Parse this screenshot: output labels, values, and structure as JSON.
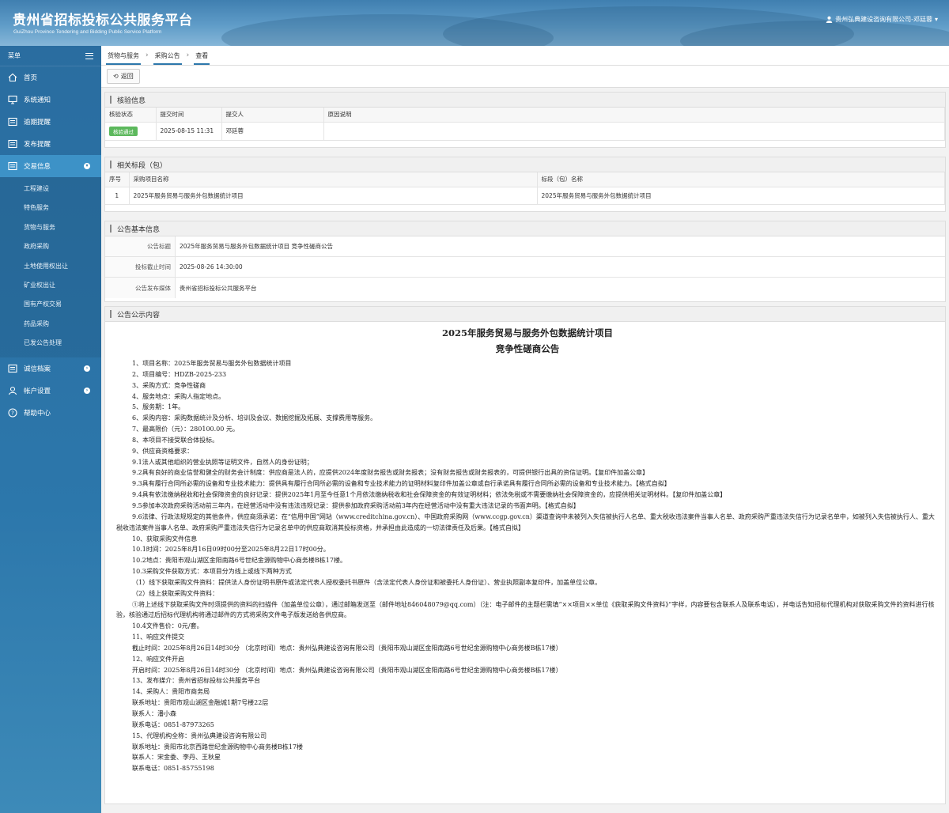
{
  "header": {
    "title": "贵州省招标投标公共服务平台",
    "subtitle": "GuiZhou Province Tendering and Bidding Public Service Platform",
    "user": "贵州弘典建设咨询有限公司-邓廷蓉"
  },
  "sidebar": {
    "menu_label": "菜单",
    "items": [
      {
        "label": "首页",
        "icon": "home-icon"
      },
      {
        "label": "系统通知",
        "icon": "monitor-icon"
      },
      {
        "label": "逾期提醒",
        "icon": "list-icon"
      },
      {
        "label": "发布提醒",
        "icon": "list-icon"
      },
      {
        "label": "交易信息",
        "icon": "list-icon"
      }
    ],
    "sub_items": [
      "工程建设",
      "特色服务",
      "货物与服务",
      "政府采购",
      "土地使用权出让",
      "矿业权出让",
      "国有产权交易",
      "药品采购",
      "已发公告处理"
    ],
    "bottom_items": [
      {
        "label": "诚信档案",
        "icon": "list-icon"
      },
      {
        "label": "帐户设置",
        "icon": "user-icon"
      },
      {
        "label": "帮助中心",
        "icon": "help-icon"
      }
    ]
  },
  "breadcrumb": [
    "货物与服务",
    "采购公告",
    "查看"
  ],
  "toolbar": {
    "back_label": "返回"
  },
  "verify": {
    "title": "核验信息",
    "columns": [
      "核验状态",
      "提交时间",
      "提交人",
      "原因说明"
    ],
    "row": {
      "status": "核验通过",
      "time": "2025-08-15 11:31",
      "submitter": "邓廷蓉",
      "reason": ""
    }
  },
  "sections": {
    "title": "相关标段（包）",
    "columns": [
      "序号",
      "采购项目名称",
      "标段（包）名称"
    ],
    "row": {
      "no": "1",
      "project": "2025年服务贸易与服务外包数据统计项目",
      "section": "2025年服务贸易与服务外包数据统计项目"
    }
  },
  "basic": {
    "title": "公告基本信息",
    "rows": [
      {
        "label": "公告标题",
        "value": "2025年服务贸易与服务外包数据统计项目 竞争性磋商公告"
      },
      {
        "label": "投标截止时间",
        "value": "2025-08-26 14:30:00"
      },
      {
        "label": "公告发布媒体",
        "value": "贵州省招标投标公共服务平台"
      }
    ]
  },
  "notice": {
    "title": "公告公示内容",
    "heading1": "2025年服务贸易与服务外包数据统计项目",
    "heading2": "竞争性磋商公告",
    "lines": [
      "1、项目名称：2025年服务贸易与服务外包数据统计项目",
      "2、项目编号：HDZB-2025-233",
      "3、采购方式：竞争性磋商",
      "4、服务地点：采购人指定地点。",
      "5、服务期：1年。",
      "6、采购内容：采购数据统计及分析、培训及会议、数据挖掘及拓展、支撑费用等服务。",
      "7、最高限价（元）：280100.00 元。",
      "8、本项目不接受联合体投标。",
      "9、供应商资格要求：",
      "9.1法人或其他组织的营业执照等证明文件，自然人的身份证明；",
      "9.2具有良好的商业信誉和健全的财务会计制度：供应商是法人的，应提供2024年度财务报告或财务报表；没有财务报告或财务报表的，可提供银行出具的资信证明。【复印件加盖公章】",
      "9.3具有履行合同所必需的设备和专业技术能力：提供具有履行合同所必需的设备和专业技术能力的证明材料复印件加盖公章或自行承诺具有履行合同所必需的设备和专业技术能力。【格式自拟】",
      "9.4具有依法缴纳税收和社会保障资金的良好记录：提供2025年1月至今任意1个月依法缴纳税收和社会保障资金的有效证明材料；依法免税或不需要缴纳社会保障资金的，应提供相关证明材料。【复印件加盖公章】",
      "9.5参加本次政府采购活动前三年内，在经营活动中没有违法违规记录：提供参加政府采购活动前3年内在经营活动中没有重大违法记录的书面声明。【格式自拟】",
      "9.6法律、行政法规规定的其他条件，供应商须承诺：在“信用中国”网站（www.creditchina.gov.cn）、中国政府采购网（www.ccgp.gov.cn）渠道查询中未被列入失信被执行人名单、重大税收违法案件当事人名单、政府采购严重违法失信行为记录名单中，如被列入失信被执行人、重大税收违法案件当事人名单、政府采购严重违法失信行为记录名单中的供应商取消其投标资格，并承担由此造成的一切法律责任及后果。【格式自拟】",
      "10、获取采购文件信息",
      "10.1时间：2025年8月16日09时00分至2025年8月22日17时00分。",
      "10.2地点：贵阳市观山湖区金阳南路6号世纪金源购物中心商务楼B栋17楼。",
      "10.3采购文件获取方式：本项目分为线上或线下两种方式",
      "（1）线下获取采购文件资料：提供法人身份证明书原件或法定代表人授权委托书原件（含法定代表人身份证和被委托人身份证）、营业执照副本复印件，加盖单位公章。",
      "（2）线上获取采购文件资料：",
      "①将上述线下获取采购文件时须提供的资料的扫描件（加盖单位公章），通过邮箱发送至（邮件地址846048079@qq.com）（注：电子邮件的主题栏需填“××项目××单位《获取采购文件资料》”字样，内容要包含联系人及联系电话），并电话告知招标代理机构对获取采购文件的资料进行核验，核验通过后招标代理机构将通过邮件的方式将采购文件电子版发送给各供应商。",
      "10.4文件售价：0元/套。",
      "11、响应文件提交",
      "截止时间：2025年8月26日14时30分  （北京时间）地点：贵州弘典建设咨询有限公司（贵阳市观山湖区金阳南路6号世纪金源购物中心商务楼B栋17楼）",
      "12、响应文件开启",
      "开启时间：2025年8月26日14时30分  （北京时间）地点：贵州弘典建设咨询有限公司（贵阳市观山湖区金阳南路6号世纪金源购物中心商务楼B栋17楼）",
      "13、发布媒介：贵州省招标投标公共服务平台",
      "14、采购人：贵阳市商务局",
      "联系地址：贵阳市观山湖区金融城1期7号楼22层",
      "联系人：潘小森",
      "联系电话：0851-87973265",
      "15、代理机构全称：贵州弘典建设咨询有限公司",
      "联系地址：贵阳市北京西路世纪金源购物中心商务楼B栋17楼",
      "联系人：宋金委、李丹、王秋星",
      "联系电话：0851-85755198"
    ]
  }
}
